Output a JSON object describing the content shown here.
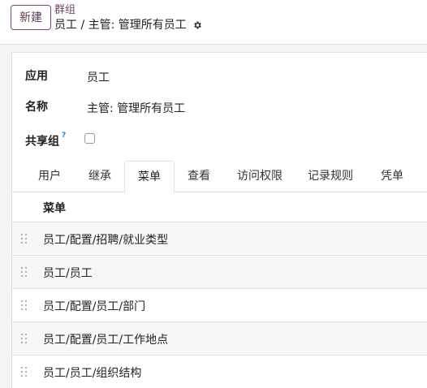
{
  "header": {
    "new_label": "新建",
    "breadcrumb_root": "群组",
    "breadcrumb_current": "员工 / 主管: 管理所有员工"
  },
  "form": {
    "app_label": "应用",
    "app_value": "员工",
    "name_label": "名称",
    "name_value": "主管: 管理所有员工",
    "shared_label": "共享组",
    "shared_help": "?",
    "shared_checked": false
  },
  "tabs": [
    {
      "label": "用户"
    },
    {
      "label": "继承"
    },
    {
      "label": "菜单"
    },
    {
      "label": "查看"
    },
    {
      "label": "访问权限"
    },
    {
      "label": "记录规则"
    },
    {
      "label": "凭单"
    }
  ],
  "active_tab": "菜单",
  "menu_list": {
    "column_header": "菜单",
    "rows": [
      {
        "label": "员工/配置/招聘/就业类型"
      },
      {
        "label": "员工/员工"
      },
      {
        "label": "员工/配置/员工/部门"
      },
      {
        "label": "员工/配置/员工/工作地点"
      },
      {
        "label": "员工/员工/组织结构"
      }
    ]
  },
  "icons": {
    "settings": "gear-icon",
    "drag": "drag-handle-icon"
  },
  "colors": {
    "accent": "#7a4d70",
    "breadcrumb": "#6f4a67",
    "help": "#2c7fc1"
  }
}
